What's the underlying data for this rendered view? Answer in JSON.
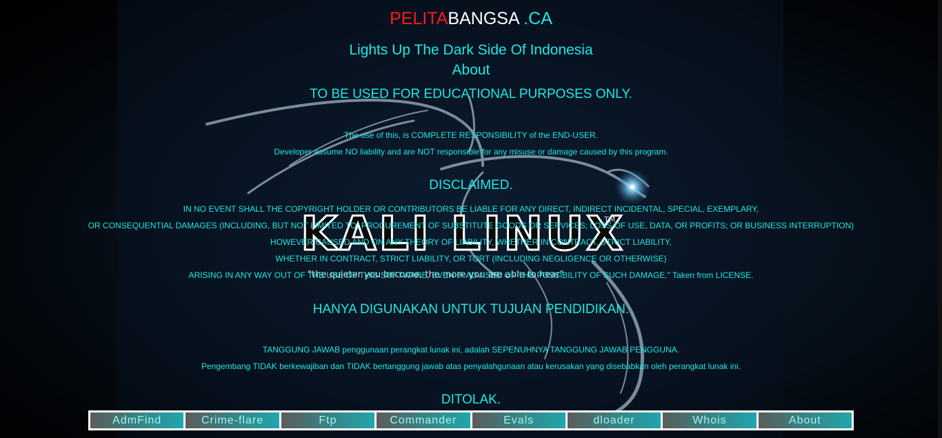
{
  "brand": {
    "part1": "PELITA",
    "part2": "BANGSA",
    "part3": " .CA"
  },
  "tagline": "Lights Up The Dark Side Of Indonesia",
  "about_heading": "About",
  "warning_en": "TO BE USED FOR EDUCATIONAL PURPOSES ONLY.",
  "responsibility_en": [
    "The use of this, is COMPLETE RESPONSIBILITY of the END-USER.",
    "Developer assume NO liability and are NOT responsible for any misuse or damage caused by this program."
  ],
  "disclaimed_heading": "DISCLAIMED.",
  "disclaimer_lines": [
    "IN NO EVENT SHALL THE COPYRIGHT HOLDER OR CONTRIBUTORS BE LIABLE FOR ANY DIRECT, INDIRECT INCIDENTAL, SPECIAL, EXEMPLARY,",
    "OR CONSEQUENTIAL DAMAGES (INCLUDING, BUT NOT LIMITED TO, PROCUREMENT OF SUBSTITUTE GOODS OR SERVICES; LOSS OF USE, DATA, OR PROFITS; OR BUSINESS INTERRUPTION)",
    "HOWEVER CAUSED AND ON ANY THEORY OF LIABILITY, WHETHER IN CONTRACT, STRICT LIABILITY,",
    "WHETHER IN CONTRACT, STRICT LIABILITY, OR TORT (INCLUDING NEGLIGENCE OR OTHERWISE)",
    "ARISING IN ANY WAY OUT OF THE USE OF THIS SOFTWARE, EVEN IF ADVISED OF THE POSSIBILITY OF SUCH DAMAGE.\" Taken from LICENSE."
  ],
  "warning_id": "HANYA DIGUNAKAN UNTUK TUJUAN PENDIDIKAN.",
  "responsibility_id": [
    "TANGGUNG JAWAB penggunaan perangkat lunak ini, adalah SEPENUHNYA TANGGUNG JAWAB PENGGUNA.",
    "Pengembang TIDAK berkewajiban dan TIDAK bertanggung jawab atas penyalahgunaan atau kerusakan yang disebabkan oleh perangkat lunak ini."
  ],
  "ditolak_heading": "DITOLAK.",
  "wallpaper": {
    "logo_text": "KALI LINUX",
    "logo_tm": "TM",
    "quote": "\"the quieter you become, the more you are able to hear\""
  },
  "nav": {
    "items": [
      "AdmFind",
      "Crime-flare",
      "Ftp",
      "Commander",
      "Evals",
      "dloader",
      "Whois",
      "About"
    ]
  },
  "colors": {
    "text": "#1de9e4",
    "brand_red": "#ff1a1a",
    "brand_white": "#ffffff",
    "background": "#000000"
  }
}
